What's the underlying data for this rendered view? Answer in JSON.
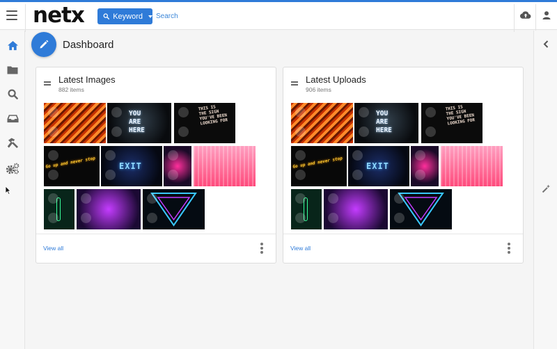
{
  "app": {
    "logo": "netx",
    "keyword_button": "Keyword",
    "search_placeholder": "Search"
  },
  "page": {
    "title": "Dashboard"
  },
  "sidebar": {
    "items": [
      {
        "icon": "home-icon",
        "active": true
      },
      {
        "icon": "folder-icon"
      },
      {
        "icon": "search-icon"
      },
      {
        "icon": "inbox-icon"
      },
      {
        "icon": "hammer-icon"
      },
      {
        "icon": "gears-icon"
      }
    ]
  },
  "cards": [
    {
      "title": "Latest Images",
      "count": "882 items",
      "view_all": "View all",
      "thumbs": [
        "orange-stairs",
        "you-are-here",
        "text-wall",
        "go-up-and-never-stop",
        "exit-sign",
        "pink-lights",
        "pink-bars",
        "cactus",
        "purple-tunnel",
        "triangle"
      ]
    },
    {
      "title": "Latest Uploads",
      "count": "906 items",
      "view_all": "View all",
      "thumbs": [
        "orange-stairs",
        "you-are-here",
        "text-wall",
        "go-up-and-never-stop",
        "exit-sign",
        "pink-lights",
        "pink-bars",
        "cactus",
        "purple-tunnel",
        "triangle"
      ]
    }
  ],
  "neon_text": {
    "you_are_here": [
      "YOU",
      "ARE",
      "HERE"
    ],
    "go_up": "Go up and never stop",
    "exit": "EXIT",
    "wall_lines": [
      "THIS IS",
      "THE SIGN",
      "YOU'VE BEEN",
      "LOOKING FOR"
    ]
  },
  "colors": {
    "accent": "#2f7bd8"
  }
}
